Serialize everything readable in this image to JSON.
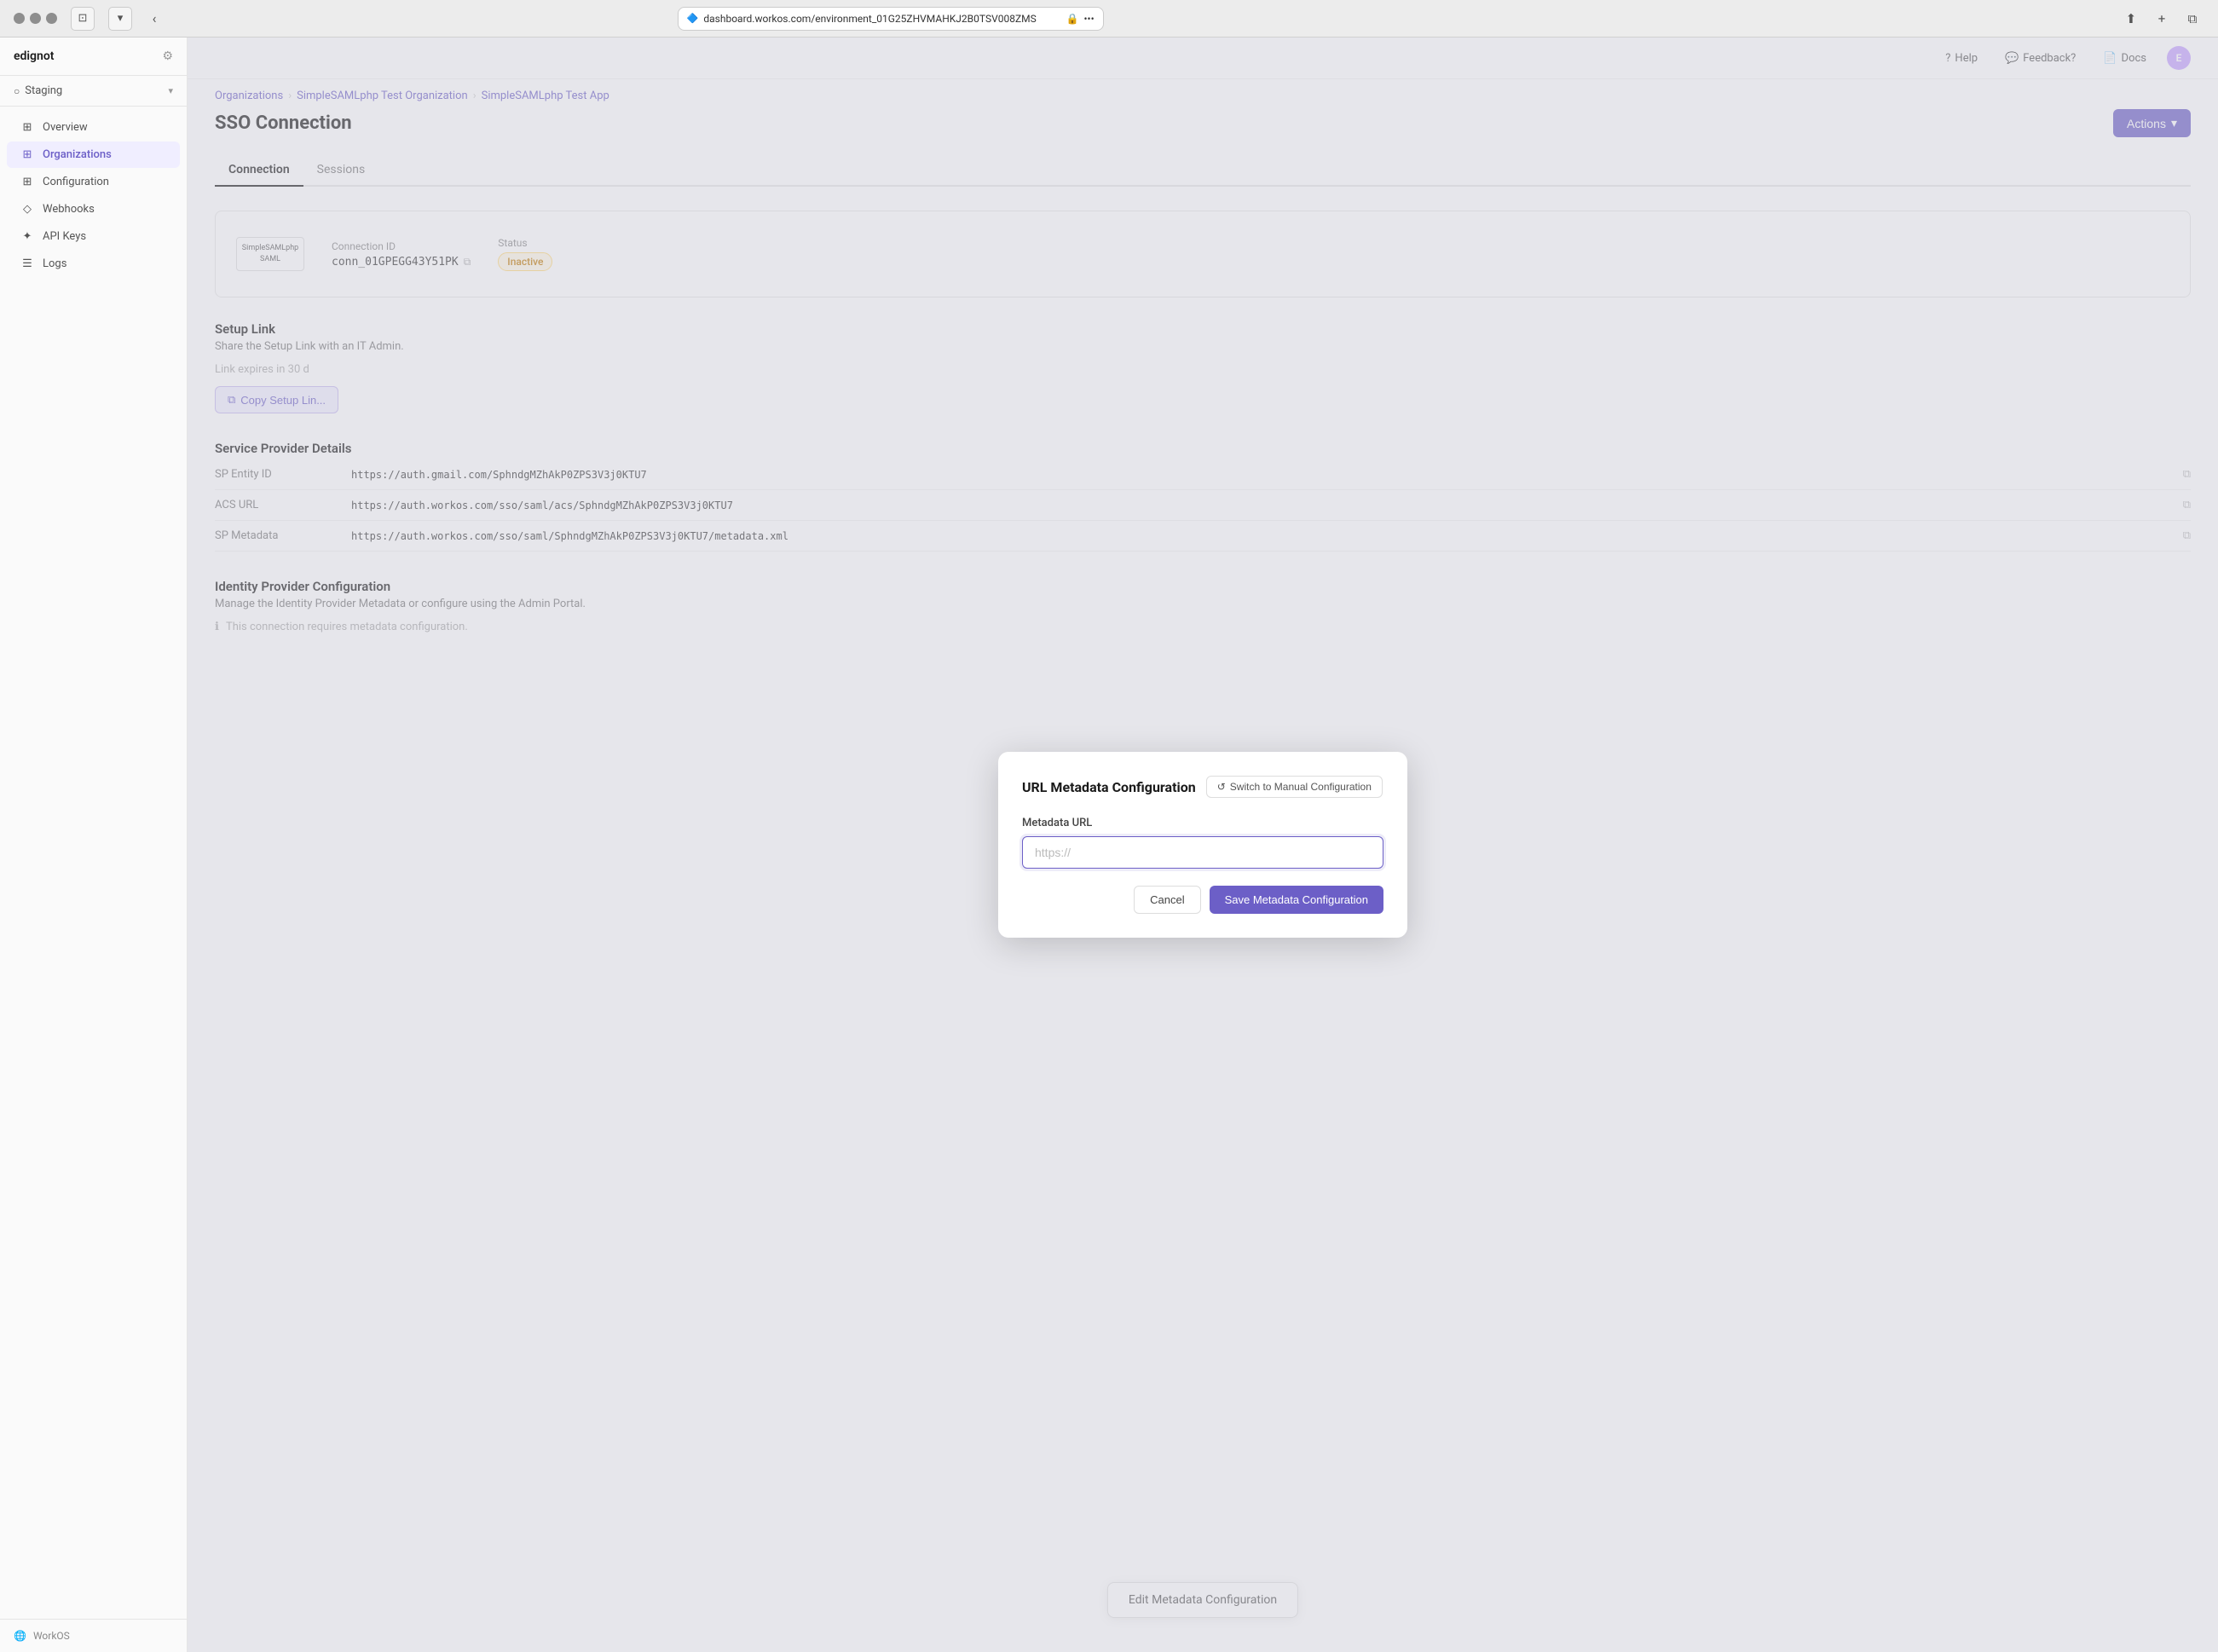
{
  "titlebar": {
    "url": "dashboard.workos.com/environment_01G25ZHVMAHKJ2B0TSV008ZMS",
    "lock_icon": "🔒"
  },
  "sidebar": {
    "brand": "edignot",
    "environment": "Staging",
    "settings_tooltip": "Settings",
    "nav_items": [
      {
        "id": "overview",
        "label": "Overview",
        "icon": "⊞"
      },
      {
        "id": "organizations",
        "label": "Organizations",
        "icon": "⊞",
        "active": true
      },
      {
        "id": "configuration",
        "label": "Configuration",
        "icon": "⊞"
      },
      {
        "id": "webhooks",
        "label": "Webhooks",
        "icon": "◇"
      },
      {
        "id": "api-keys",
        "label": "API Keys",
        "icon": "✦"
      },
      {
        "id": "logs",
        "label": "Logs",
        "icon": "☰"
      }
    ],
    "bottom_label": "WorkOS"
  },
  "topbar": {
    "help_label": "Help",
    "feedback_label": "Feedback?",
    "docs_label": "Docs",
    "user_initials": "E"
  },
  "breadcrumb": {
    "items": [
      "Organizations",
      "SimpleSAMLphp Test Organization",
      "SimpleSAMLphp Test App"
    ]
  },
  "page": {
    "title": "SSO Connection",
    "actions_label": "Actions"
  },
  "tabs": [
    {
      "id": "connection",
      "label": "Connection",
      "active": true
    },
    {
      "id": "sessions",
      "label": "Sessions",
      "active": false
    }
  ],
  "connection": {
    "provider_name": "SimpleSAMLphp SAML",
    "provider_logo_lines": [
      "SimpleSAMLphp",
      "SAML"
    ],
    "connection_id_label": "Connection ID",
    "connection_id_value": "conn_01GPEGG43Y51PK",
    "status_label": "Status",
    "status_value": "Inactive"
  },
  "setup_link": {
    "title": "Setup Link",
    "description": "Share the Setup Link with an IT Admin.",
    "expiry": "Link expires in 30 d",
    "copy_btn_label": "Copy Setup Lin..."
  },
  "sp_details": {
    "title": "Service Provider Details",
    "rows": [
      {
        "label": "SP Entity ID",
        "value": "https://auth.gmail.com/SphndgMZhAkP0ZPS3V3j0KTU7"
      },
      {
        "label": "ACS URL",
        "value": "https://auth.workos.com/sso/saml/acs/SphndgMZhAkP0ZPS3V3j0KTU7"
      },
      {
        "label": "SP Metadata",
        "value": "https://auth.workos.com/sso/saml/SphndgMZhAkP0ZPS3V3j0KTU7/metadata.xml"
      }
    ]
  },
  "idp": {
    "title": "Identity Provider Configuration",
    "description": "Manage the Identity Provider Metadata or configure using the Admin Portal.",
    "notice": "This connection requires metadata configuration.",
    "edit_btn_label": "Edit Metadata Configuration"
  },
  "modal": {
    "title": "URL Metadata Configuration",
    "switch_btn_label": "Switch to Manual Configuration",
    "switch_icon": "↺",
    "field_label": "Metadata URL",
    "field_placeholder": "https://",
    "cancel_label": "Cancel",
    "save_label": "Save Metadata Configuration"
  }
}
